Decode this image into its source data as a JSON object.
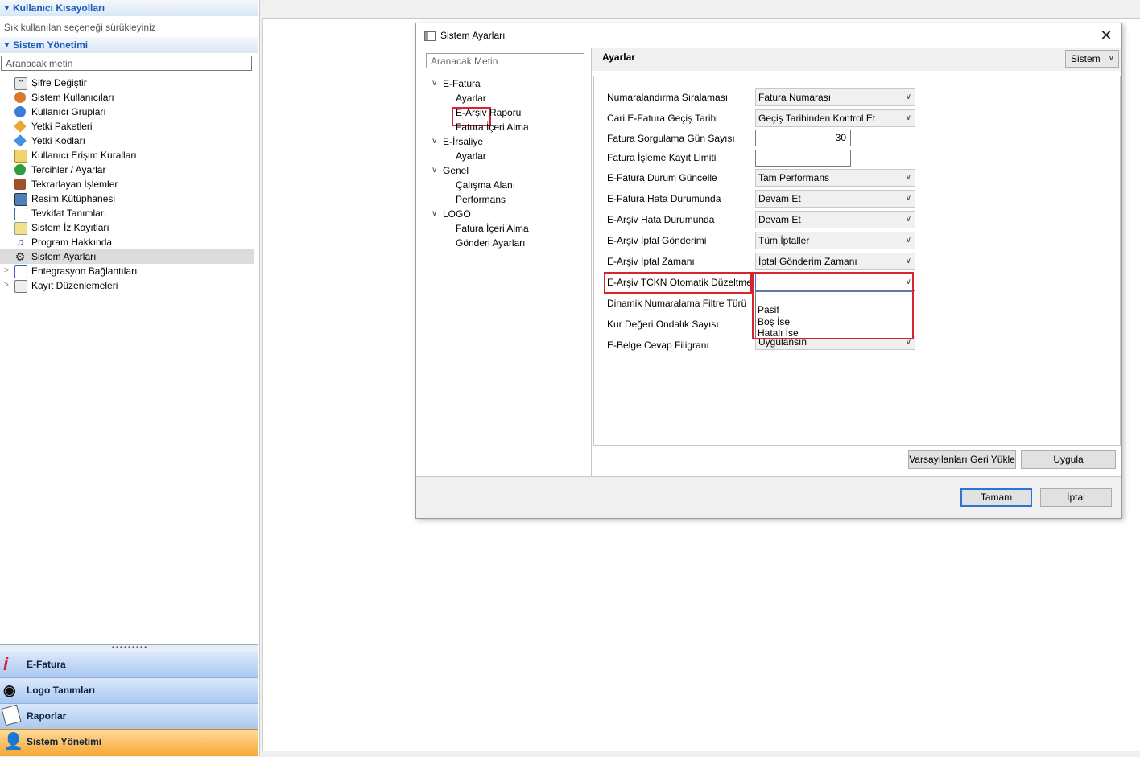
{
  "left_panel": {
    "shortcuts_header": "Kullanıcı Kısayolları",
    "shortcuts_hint": "Sık kullanılan seçeneği sürükleyiniz",
    "system_header": "Sistem Yönetimi",
    "search_placeholder": "Aranacak metin",
    "items": [
      {
        "label": "Şifre Değiştir",
        "icon": "password-icon"
      },
      {
        "label": "Sistem Kullanıcıları",
        "icon": "users-icon"
      },
      {
        "label": "Kullanıcı Grupları",
        "icon": "user-groups-icon"
      },
      {
        "label": "Yetki Paketleri",
        "icon": "key-icon"
      },
      {
        "label": "Yetki Kodları",
        "icon": "key-blue-icon"
      },
      {
        "label": "Kullanıcı Erişim Kuralları",
        "icon": "access-rules-icon"
      },
      {
        "label": "Tercihler / Ayarlar",
        "icon": "preferences-icon"
      },
      {
        "label": "Tekrarlayan İşlemler",
        "icon": "recurring-icon"
      },
      {
        "label": "Resim Kütüphanesi",
        "icon": "image-library-icon"
      },
      {
        "label": "Tevkifat Tanımları",
        "icon": "list-icon"
      },
      {
        "label": "Sistem İz Kayıtları",
        "icon": "audit-icon"
      },
      {
        "label": "Program Hakkında",
        "icon": "music-note-icon"
      },
      {
        "label": "Sistem Ayarları",
        "icon": "gear-icon"
      },
      {
        "label": "Entegrasyon Bağlantıları",
        "icon": "integration-icon"
      },
      {
        "label": "Kayıt Düzenlemeleri",
        "icon": "record-edit-icon"
      }
    ],
    "outlook": [
      {
        "label": "E-Fatura",
        "icon": "efatura-icon"
      },
      {
        "label": "Logo Tanımları",
        "icon": "logo-eye-icon"
      },
      {
        "label": "Raporlar",
        "icon": "reports-icon"
      },
      {
        "label": "Sistem Yönetimi",
        "icon": "admin-user-icon"
      }
    ]
  },
  "dialog": {
    "title": "Sistem Ayarları",
    "close": "✕",
    "tree_search_placeholder": "Aranacak Metin",
    "tree": [
      {
        "label": "E-Fatura",
        "level": 0
      },
      {
        "label": "Ayarlar",
        "level": 1
      },
      {
        "label": "E-Arşiv Raporu",
        "level": 1
      },
      {
        "label": "Fatura İçeri Alma",
        "level": 1
      },
      {
        "label": "E-İrsaliye",
        "level": 0
      },
      {
        "label": "Ayarlar",
        "level": 1
      },
      {
        "label": "Genel",
        "level": 0
      },
      {
        "label": "Çalışma Alanı",
        "level": 1
      },
      {
        "label": "Performans",
        "level": 1
      },
      {
        "label": "LOGO",
        "level": 0
      },
      {
        "label": "Fatura İçeri Alma",
        "level": 1
      },
      {
        "label": "Gönderi Ayarları",
        "level": 1
      }
    ],
    "section_title": "Ayarlar",
    "scope_value": "Sistem",
    "fields": [
      {
        "label": "Numaralandırma Sıralaması",
        "value": "Fatura Numarası"
      },
      {
        "label": "Cari E-Fatura Geçiş Tarihi",
        "value": "Geçiş Tarihinden Kontrol Et"
      },
      {
        "label": "Fatura Sorgulama Gün Sayısı",
        "value": "30"
      },
      {
        "label": "Fatura İşleme Kayıt Limiti",
        "value": ""
      },
      {
        "label": "E-Fatura Durum Güncelle",
        "value": "Tam Performans"
      },
      {
        "label": "E-Fatura Hata Durumunda",
        "value": "Devam Et"
      },
      {
        "label": "E-Arşiv Hata Durumunda",
        "value": "Devam Et"
      },
      {
        "label": "E-Arşiv İptal Gönderimi",
        "value": "Tüm İptaller"
      },
      {
        "label": "E-Arşiv İptal Zamanı",
        "value": "İptal Gönderim Zamanı"
      },
      {
        "label": "E-Arşiv TCKN Otomatik Düzeltme",
        "value": ""
      },
      {
        "label": "Dinamik Numaralama Filtre Türü",
        "value": ""
      },
      {
        "label": "Kur Değeri Ondalık Sayısı",
        "value": ""
      },
      {
        "label": "E-Belge Cevap Filigranı",
        "value": "Uygulansın"
      }
    ],
    "dropdown_options": [
      "",
      "Pasif",
      "Boş İse",
      "Hatalı İse"
    ],
    "restore_defaults": "Varsayılanları Geri Yükle",
    "apply": "Uygula",
    "ok": "Tamam",
    "cancel": "İptal"
  },
  "colors": {
    "highlight_red": "#d9232e",
    "header_blue": "#1a5cb8",
    "active_orange": "#f7a832"
  }
}
